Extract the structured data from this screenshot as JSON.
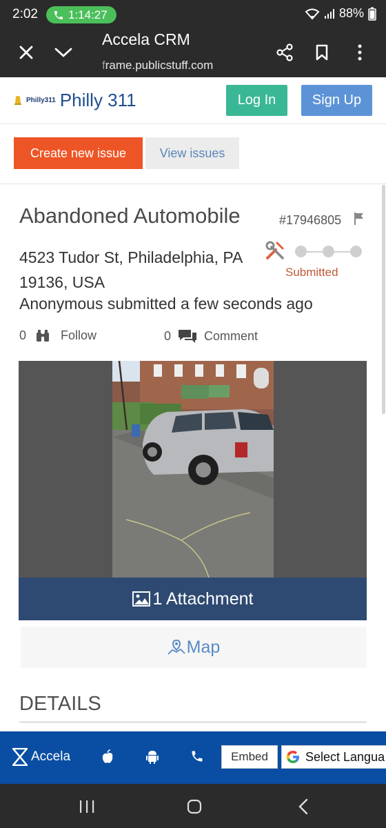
{
  "status_bar": {
    "time": "2:02",
    "call_timer": "1:14:27",
    "battery": "88%"
  },
  "browser": {
    "title": "Accela CRM",
    "url_dim": "f",
    "url_rest": "rame.publicstuff.com"
  },
  "header": {
    "logo_small": "Philly311",
    "logo_name": "Philly 311",
    "login_label": "Log In",
    "signup_label": "Sign Up"
  },
  "actions": {
    "create_label": "Create new issue",
    "view_label": "View issues"
  },
  "issue": {
    "title": "Abandoned Automobile",
    "id": "#17946805",
    "address_line1": "4523 Tudor St, Philadelphia, PA",
    "address_line2": "19136, USA",
    "submitted_by": "Anonymous submitted a few seconds ago",
    "status": "Submitted",
    "follow_count": "0",
    "follow_label": "Follow",
    "comment_count": "0",
    "comment_label": "Comment",
    "attachment_label": "1 Attachment",
    "map_label": "Map",
    "details_heading": "DETAILS"
  },
  "footer": {
    "brand": "Accela",
    "embed_label": "Embed",
    "language_label": "Select Langua"
  },
  "colors": {
    "accent_green": "#3ab795",
    "accent_blue": "#5b93d6",
    "create_orange": "#ee5526",
    "attach_navy": "#2e4a72",
    "footer_blue": "#0a4ea3",
    "status_text": "#c0593a"
  }
}
